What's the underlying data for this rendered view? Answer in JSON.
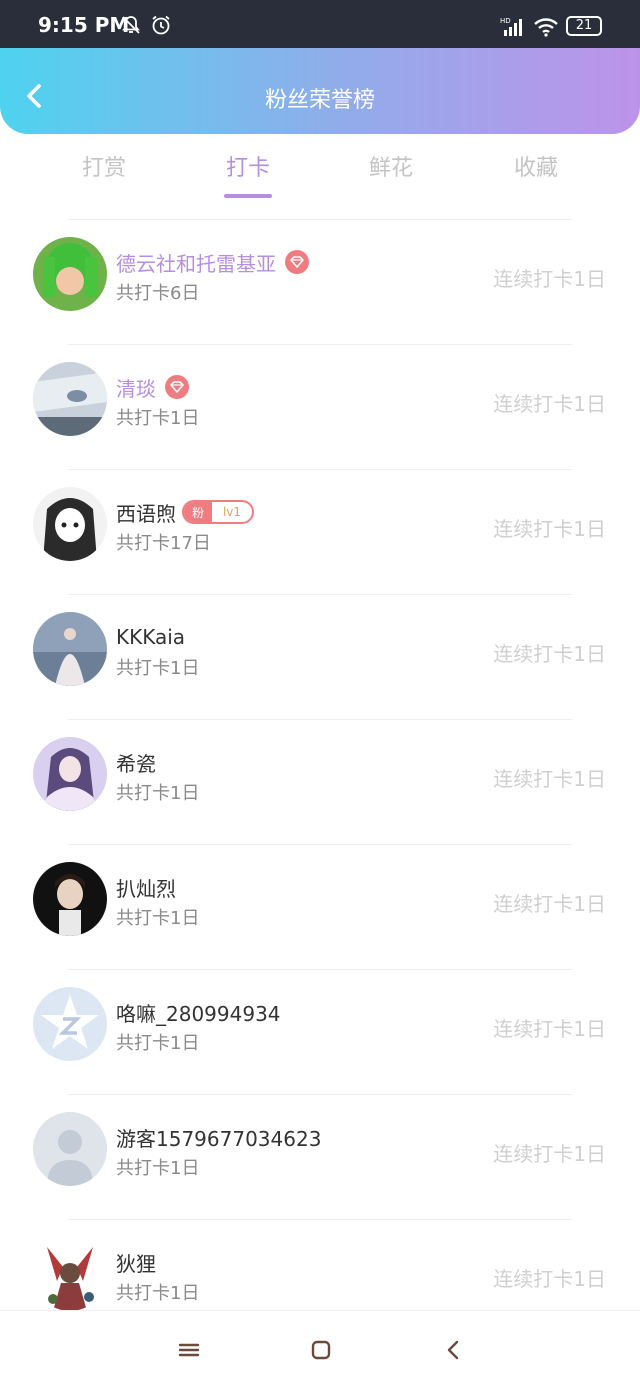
{
  "status_bar": {
    "time": "9:15 PM",
    "battery": "21",
    "hd_label": "HD"
  },
  "header": {
    "title": "粉丝荣誉榜",
    "gradient_start": "#4ed3ef",
    "gradient_end": "#bd93e9"
  },
  "tabs": [
    {
      "label": "打赏",
      "active": false
    },
    {
      "label": "打卡",
      "active": true
    },
    {
      "label": "鲜花",
      "active": false
    },
    {
      "label": "收藏",
      "active": false
    }
  ],
  "fans": [
    {
      "name": "德云社和托雷基亚",
      "total": "共打卡6日",
      "streak": "连续打卡1日",
      "vip": true,
      "badge": "gem"
    },
    {
      "name": "清琰",
      "total": "共打卡1日",
      "streak": "连续打卡1日",
      "vip": true,
      "badge": "gem"
    },
    {
      "name": "西语煦",
      "total": "共打卡17日",
      "streak": "连续打卡1日",
      "vip": false,
      "badge": "fan",
      "fan_label": "粉",
      "fan_level": "lv1"
    },
    {
      "name": "KKKaia",
      "total": "共打卡1日",
      "streak": "连续打卡1日",
      "vip": false
    },
    {
      "name": "希瓷",
      "total": "共打卡1日",
      "streak": "连续打卡1日",
      "vip": false
    },
    {
      "name": "扒灿烈",
      "total": "共打卡1日",
      "streak": "连续打卡1日",
      "vip": false
    },
    {
      "name": "咯嘛_280994934",
      "total": "共打卡1日",
      "streak": "连续打卡1日",
      "vip": false
    },
    {
      "name": "游客1579677034623",
      "total": "共打卡1日",
      "streak": "连续打卡1日",
      "vip": false
    },
    {
      "name": "狄狸",
      "total": "共打卡1日",
      "streak": "连续打卡1日",
      "vip": false
    }
  ],
  "colors": {
    "accent": "#b68fe0",
    "gem": "#ee7c80",
    "muted": "#cfcfcf"
  }
}
